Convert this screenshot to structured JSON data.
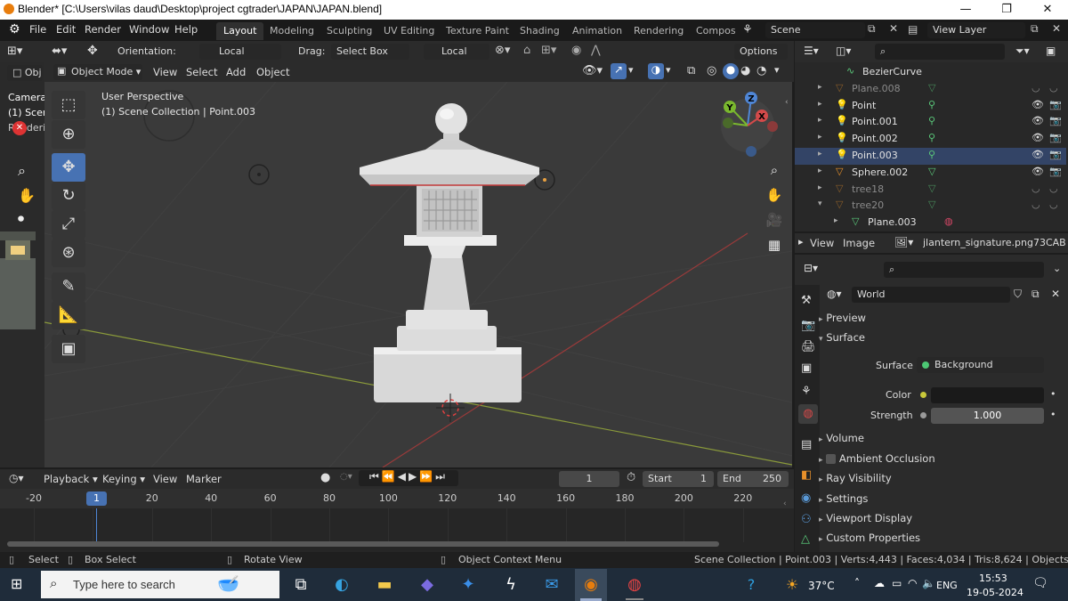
{
  "window": {
    "title": "Blender* [C:\\Users\\vilas daud\\Desktop\\project cgtrader\\JAPAN\\JAPAN.blend]",
    "min": "—",
    "max": "❐",
    "close": "✕"
  },
  "menubar": {
    "items": [
      "File",
      "Edit",
      "Render",
      "Window",
      "Help"
    ],
    "tabs": [
      "Layout",
      "Modeling",
      "Sculpting",
      "UV Editing",
      "Texture Paint",
      "Shading",
      "Animation",
      "Rendering",
      "Compos"
    ],
    "scene": "Scene",
    "view_layer": "View Layer"
  },
  "toolheader": {
    "orientation_label": "Orientation:",
    "orientation_value": "Local",
    "drag_label": "Drag:",
    "drag_value": "Select Box",
    "pivot_value": "Local",
    "options": "Options"
  },
  "viewport_header": {
    "mode": "Object Mode",
    "menus": [
      "View",
      "Select",
      "Add",
      "Object"
    ],
    "left_trunc": "Obj"
  },
  "viewport": {
    "perspective": "User Perspective",
    "collection": "(1) Scene Collection | Point.003",
    "left_overlay": [
      "Camera",
      "(1) Scen",
      "Renderir"
    ],
    "gizmo": {
      "x": "X",
      "y": "Y",
      "z": "Z"
    }
  },
  "outliner": {
    "rows": [
      {
        "name": "BezierCurve",
        "dim": false,
        "icon": "curve-icon"
      },
      {
        "name": "Plane.008",
        "dim": true,
        "icon": "object-icon"
      },
      {
        "name": "Point",
        "dim": false,
        "icon": "light-icon"
      },
      {
        "name": "Point.001",
        "dim": false,
        "icon": "light-icon"
      },
      {
        "name": "Point.002",
        "dim": false,
        "icon": "light-icon"
      },
      {
        "name": "Point.003",
        "dim": false,
        "icon": "light-icon"
      },
      {
        "name": "Sphere.002",
        "dim": false,
        "icon": "object-icon"
      },
      {
        "name": "tree18",
        "dim": true,
        "icon": "object-icon"
      },
      {
        "name": "tree20",
        "dim": true,
        "icon": "object-icon"
      },
      {
        "name": "Plane.003",
        "dim": false,
        "icon": "mesh-icon"
      }
    ]
  },
  "image_header": {
    "menus": [
      "View",
      "Image"
    ],
    "image_name": "jlantern_signature.png73CAB4D..."
  },
  "properties": {
    "world_name": "World",
    "panels": {
      "preview": "Preview",
      "surface": "Surface",
      "volume": "Volume",
      "ao": "Ambient Occlusion",
      "ray": "Ray Visibility",
      "settings": "Settings",
      "viewport_display": "Viewport Display",
      "custom": "Custom Properties"
    },
    "surface_label": "Surface",
    "surface_value": "Background",
    "color_label": "Color",
    "strength_label": "Strength",
    "strength_value": "1.000"
  },
  "timeline": {
    "menus": [
      "Playback",
      "Keying",
      "View",
      "Marker"
    ],
    "current_frame": "1",
    "start_label": "Start",
    "start_value": "1",
    "end_label": "End",
    "end_value": "250",
    "ticks": [
      "-20",
      "0",
      "20",
      "40",
      "60",
      "80",
      "100",
      "120",
      "140",
      "160",
      "180",
      "200",
      "220"
    ],
    "playhead": "1"
  },
  "statusbar": {
    "select": "Select",
    "box_select": "Box Select",
    "rotate_view": "Rotate View",
    "context_menu": "Object Context Menu",
    "stats": "Scene Collection | Point.003 | Verts:4,443 | Faces:4,034 | Tris:8,624 | Objects:0/16 | 2."
  },
  "taskbar": {
    "search_placeholder": "Type here to search",
    "temperature": "37°C",
    "language": "ENG",
    "time": "15:53",
    "date": "19-05-2024"
  }
}
